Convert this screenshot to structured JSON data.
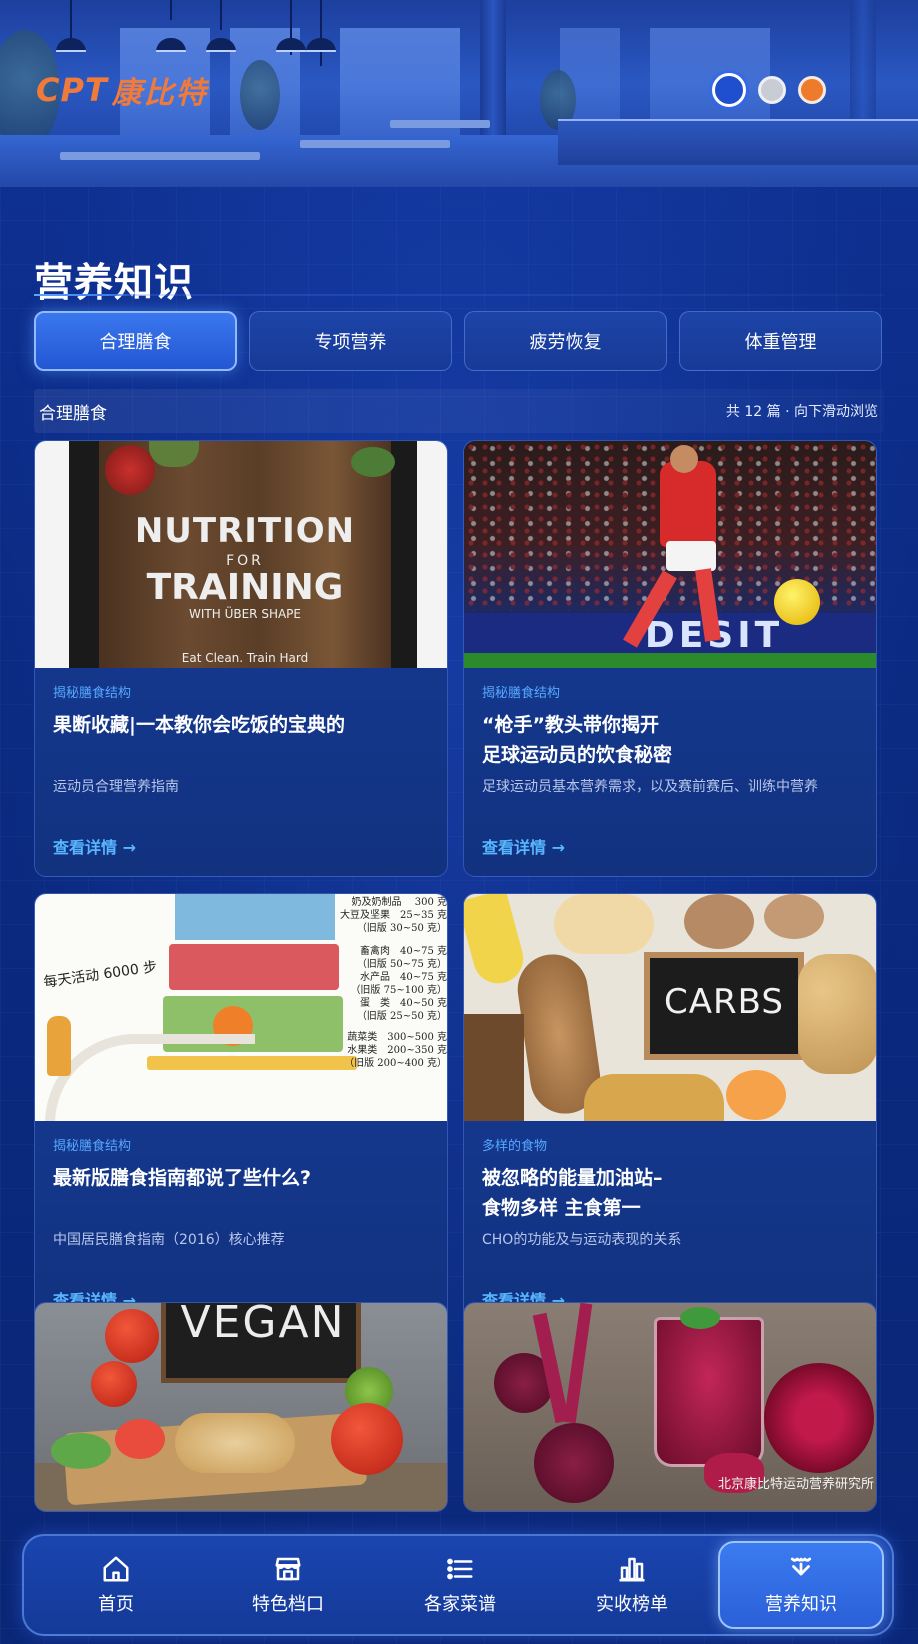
{
  "header": {
    "logo_latin": "CPT",
    "logo_cn": "康比特"
  },
  "section": {
    "title": "营养知识"
  },
  "tabs": [
    {
      "label": "合理膳食",
      "active": true
    },
    {
      "label": "专项营养",
      "active": false
    },
    {
      "label": "疲劳恢复",
      "active": false
    },
    {
      "label": "体重管理",
      "active": false
    }
  ],
  "list": {
    "category": "合理膳食",
    "count_text": "共 12 篇 · 向下滑动浏览"
  },
  "cards": [
    {
      "tag": "揭秘膳食结构",
      "title": "果断收藏|一本教你会吃饭的宝典的",
      "desc": "运动员合理营养指南",
      "more": "查看详情 →",
      "image_text": {
        "l1": "NUTRITION",
        "l2": "FOR",
        "l3": "TRAINING",
        "l4": "WITH ÜBER SHAPE",
        "l5": "Eat Clean. Train Hard"
      }
    },
    {
      "tag": "揭秘膳食结构",
      "title": "“枪手”教头带你揭开\n足球运动员的饮食秘密",
      "desc": "足球运动员基本营养需求，以及赛前赛后、训练中营养",
      "more": "查看详情 →",
      "image_text": {
        "board": "DESIT"
      }
    },
    {
      "tag": "揭秘膳食结构",
      "title": "最新版膳食指南都说了些什么?",
      "desc": "中国居民膳食指南（2016）核心推荐",
      "more": "查看详情 →",
      "image_text": {
        "steps": "每天活动 6000 步",
        "r1": "奶及奶制品　 300 克",
        "r2": "大豆及坚果　25~35 克",
        "r3": "（旧版 30~50 克）",
        "r4": "畜禽肉　40~75 克",
        "r5": "（旧版 50~75 克）",
        "r6": "水产品　40~75 克",
        "r7": "（旧版 75~100 克）",
        "r8": "蛋　类　40~50 克",
        "r9": "（旧版 25~50 克）",
        "r10": "蔬菜类　300~500 克",
        "r11": "水果类　200~350 克",
        "r12": "（旧版 200~400 克）"
      }
    },
    {
      "tag": "多样的食物",
      "title": "被忽略的能量加油站–\n食物多样 主食第一",
      "desc": "CHO的功能及与运动表现的关系",
      "more": "查看详情 →",
      "image_text": {
        "board": "CARBS"
      }
    },
    {
      "image_text": {
        "board": "VEGAN"
      }
    },
    {
      "image_text": {
        "watermark": "北京康比特运动营养研究所"
      }
    }
  ],
  "nav": [
    {
      "label": "首页",
      "icon": "home-icon",
      "active": false
    },
    {
      "label": "特色档口",
      "icon": "store-icon",
      "active": false
    },
    {
      "label": "各家菜谱",
      "icon": "list-icon",
      "active": false
    },
    {
      "label": "实收榜单",
      "icon": "bar-chart-icon",
      "active": false
    },
    {
      "label": "营养知识",
      "icon": "nutrition-icon",
      "active": true
    }
  ],
  "colors": {
    "background": "#0b2a7a",
    "accent": "#58b6ff",
    "logo": "#f07a3a",
    "active_tab": "#2f6ae2"
  }
}
